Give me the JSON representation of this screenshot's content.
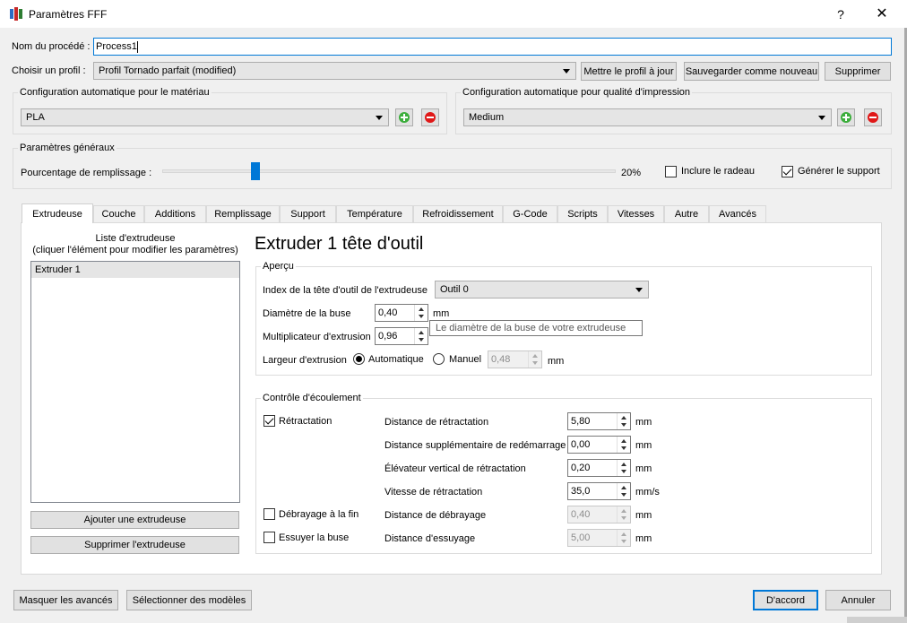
{
  "window": {
    "title": "Paramètres FFF",
    "help": "?",
    "close": "✕"
  },
  "process": {
    "label": "Nom du procédé :",
    "value": "Process1"
  },
  "profile": {
    "label": "Choisir un profil :",
    "selected": "Profil Tornado parfait (modified)",
    "update_button": "Mettre le profil à jour",
    "save_new_button": "Sauvegarder comme nouveau",
    "delete_button": "Supprimer"
  },
  "material_config": {
    "title": "Configuration automatique pour le matériau",
    "selected": "PLA"
  },
  "quality_config": {
    "title": "Configuration automatique pour qualité d'impression",
    "selected": "Medium"
  },
  "general": {
    "title": "Paramètres généraux",
    "infill_label": "Pourcentage de remplissage :",
    "infill_value": "20%",
    "infill_fraction": 0.2,
    "raft_label": "Inclure le radeau",
    "raft_checked": false,
    "support_label": "Générer le support",
    "support_checked": true
  },
  "tabs": [
    "Extrudeuse",
    "Couche",
    "Additions",
    "Remplissage",
    "Support",
    "Température",
    "Refroidissement",
    "G-Code",
    "Scripts",
    "Vitesses",
    "Autre",
    "Avancés"
  ],
  "active_tab": "Extrudeuse",
  "extruder_list": {
    "title_line1": "Liste d'extrudeuse",
    "title_line2": "(cliquer l'élément pour modifier les paramètres)",
    "items": [
      "Extruder 1"
    ],
    "add_button": "Ajouter une extrudeuse",
    "remove_button": "Supprimer l'extrudeuse"
  },
  "extruder_panel": {
    "heading": "Extruder 1 tête d'outil",
    "overview": {
      "title": "Aperçu",
      "tool_index_label": "Index de la tête d'outil de l'extrudeuse",
      "tool_index_value": "Outil 0",
      "nozzle_label": "Diamètre de la buse",
      "nozzle_value": "0,40",
      "nozzle_unit": "mm",
      "tooltip": "Le diamètre de la buse de votre extrudeuse",
      "multiplier_label": "Multiplicateur d'extrusion",
      "multiplier_value": "0,96",
      "width_label": "Largeur d'extrusion",
      "width_auto_label": "Automatique",
      "width_manual_label": "Manuel",
      "width_value": "0,48",
      "width_unit": "mm"
    },
    "flow": {
      "title": "Contrôle d'écoulement",
      "retraction_label": "Rétractation",
      "retraction_checked": true,
      "coast_label": "Débrayage à la fin",
      "coast_checked": false,
      "wipe_label": "Essuyer la buse",
      "wipe_checked": false,
      "retraction_distance_label": "Distance de rétractation",
      "retraction_distance_value": "5,80",
      "extra_restart_label": "Distance supplémentaire de redémarrage",
      "extra_restart_value": "0,00",
      "vertical_lift_label": "Élévateur vertical de rétractation",
      "vertical_lift_value": "0,20",
      "retraction_speed_label": "Vitesse de rétractation",
      "retraction_speed_value": "35,0",
      "retraction_speed_unit": "mm/s",
      "coast_distance_label": "Distance de débrayage",
      "coast_distance_value": "0,40",
      "wipe_distance_label": "Distance d'essuyage",
      "wipe_distance_value": "5,00",
      "unit_mm": "mm"
    }
  },
  "footer": {
    "hide_advanced": "Masquer les avancés",
    "select_models": "Sélectionner des modèles",
    "ok": "D'accord",
    "cancel": "Annuler"
  }
}
